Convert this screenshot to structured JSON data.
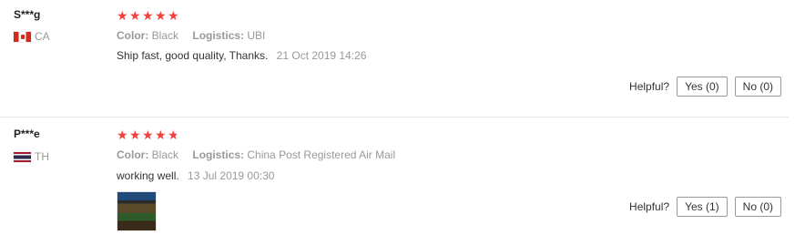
{
  "reviews": [
    {
      "user": "S***g",
      "country": "CA",
      "rating": 5,
      "color_label": "Color:",
      "color_value": "Black",
      "logistics_label": "Logistics:",
      "logistics_value": "UBI",
      "text": "Ship fast, good quality, Thanks.",
      "date": "21 Oct 2019 14:26",
      "helpful_label": "Helpful?",
      "yes_label": "Yes (0)",
      "no_label": "No (0)"
    },
    {
      "user": "P***e",
      "country": "TH",
      "rating": 4.7,
      "color_label": "Color:",
      "color_value": "Black",
      "logistics_label": "Logistics:",
      "logistics_value": "China Post Registered Air Mail",
      "text": "working well.",
      "date": "13 Jul 2019 00:30",
      "helpful_label": "Helpful?",
      "yes_label": "Yes (1)",
      "no_label": "No (0)"
    }
  ],
  "icons": {
    "star": "★",
    "star_color": "#f0413e"
  }
}
